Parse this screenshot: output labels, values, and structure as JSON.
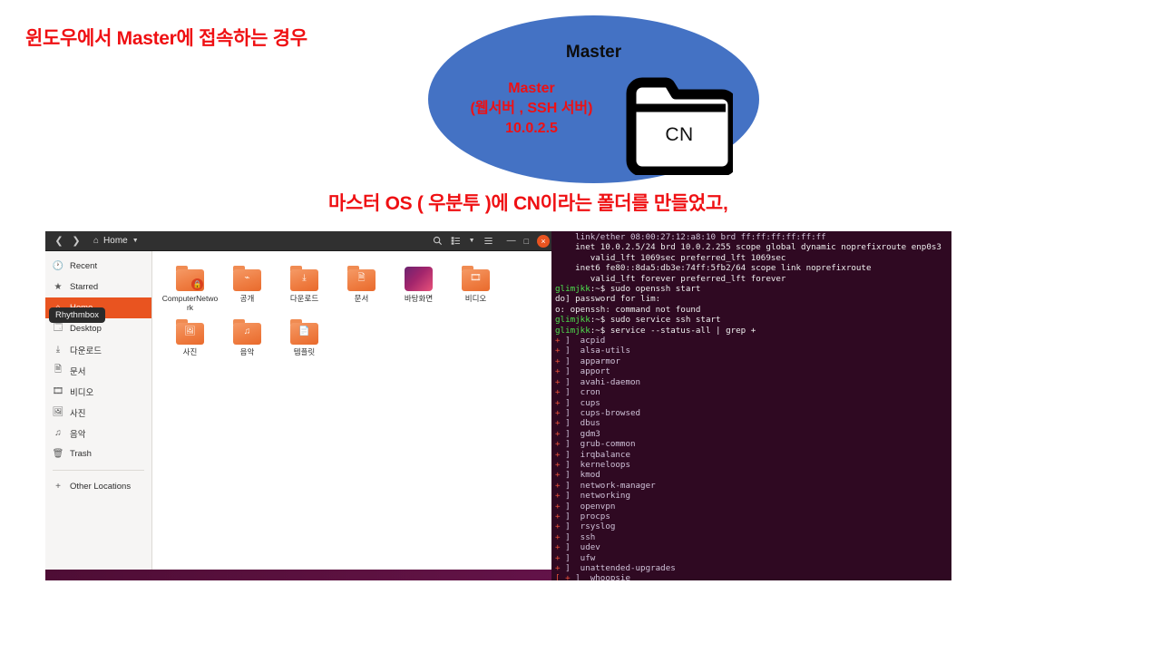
{
  "slide": {
    "heading": "윈도우에서 Master에 접속하는 경우",
    "caption": "마스터 OS ( 우분투 )에 CN이라는 폴더를 만들었고,",
    "heading_color": "#ef1013",
    "caption_color": "#ef1013"
  },
  "diagram": {
    "ellipse_color": "#4472c4",
    "title": "Master",
    "sub_line1": "Master",
    "sub_line2": "(웹서버 , SSH 서버)",
    "sub_line3": "10.0.2.5",
    "folder_label": "CN"
  },
  "file_manager": {
    "titlebar": {
      "back_icon": "chevron-left-icon",
      "forward_icon": "chevron-right-icon",
      "home_icon": "home-icon",
      "path_label": "Home",
      "path_caret": "chevron-down-icon",
      "search_icon": "search-icon",
      "view_icon": "list-view-icon",
      "view_caret": "chevron-down-icon",
      "menu_icon": "hamburger-menu-icon",
      "minimize_label": "—",
      "maximize_label": "□",
      "close_label": "×"
    },
    "tooltip": "Rhythmbox",
    "sidebar": [
      {
        "label": "Recent",
        "icon": "clock-icon",
        "glyph": "🕐",
        "active": false
      },
      {
        "label": "Starred",
        "icon": "star-icon",
        "glyph": "★",
        "active": false
      },
      {
        "label": "Home",
        "icon": "home-icon",
        "glyph": "⌂",
        "active": true
      },
      {
        "label": "Desktop",
        "icon": "desktop-icon",
        "glyph": "🗔",
        "active": false
      },
      {
        "label": "다운로드",
        "icon": "download-icon",
        "glyph": "⤓",
        "active": false
      },
      {
        "label": "문서",
        "icon": "document-icon",
        "glyph": "🗎",
        "active": false
      },
      {
        "label": "비디오",
        "icon": "video-icon",
        "glyph": "🎞",
        "active": false
      },
      {
        "label": "사진",
        "icon": "photo-icon",
        "glyph": "🖼",
        "active": false
      },
      {
        "label": "음악",
        "icon": "music-icon",
        "glyph": "♫",
        "active": false
      },
      {
        "label": "Trash",
        "icon": "trash-icon",
        "glyph": "🗑",
        "active": false
      }
    ],
    "other_locations": {
      "label": "Other Locations",
      "icon": "plus-icon",
      "glyph": "+"
    },
    "files": [
      {
        "label": "ComputerNetwork",
        "icon": "folder-locked-icon",
        "emblem": "",
        "locked": true,
        "kind": "folder"
      },
      {
        "label": "공개",
        "icon": "folder-shared-icon",
        "emblem": "⌁",
        "locked": false,
        "kind": "folder"
      },
      {
        "label": "다운로드",
        "icon": "folder-download-icon",
        "emblem": "⤓",
        "locked": false,
        "kind": "folder"
      },
      {
        "label": "문서",
        "icon": "folder-documents-icon",
        "emblem": "🗎",
        "locked": false,
        "kind": "folder"
      },
      {
        "label": "바탕화면",
        "icon": "folder-desktop-icon",
        "emblem": "",
        "locked": false,
        "kind": "desktop"
      },
      {
        "label": "비디오",
        "icon": "folder-videos-icon",
        "emblem": "🎞",
        "locked": false,
        "kind": "folder"
      },
      {
        "label": "사진",
        "icon": "folder-pictures-icon",
        "emblem": "🖼",
        "locked": false,
        "kind": "folder"
      },
      {
        "label": "음악",
        "icon": "folder-music-icon",
        "emblem": "♫",
        "locked": false,
        "kind": "folder"
      },
      {
        "label": "템플릿",
        "icon": "folder-templates-icon",
        "emblem": "📄",
        "locked": false,
        "kind": "folder"
      }
    ]
  },
  "terminal": {
    "lines": [
      {
        "segments": [
          {
            "text": "    link/ether 08:00:27:12:a8:10 brd ff:ff:ff:ff:ff:ff",
            "cls": "c-lav"
          }
        ]
      },
      {
        "segments": [
          {
            "text": "    inet 10.0.2.5/24 brd 10.0.2.255 scope global dynamic noprefixroute enp0s3",
            "cls": "c-white"
          }
        ]
      },
      {
        "segments": [
          {
            "text": "       valid_lft 1069sec preferred_lft 1069sec",
            "cls": "c-white"
          }
        ]
      },
      {
        "segments": [
          {
            "text": "    inet6 fe80::8da5:db3e:74ff:5fb2/64 scope link noprefixroute",
            "cls": "c-white"
          }
        ]
      },
      {
        "segments": [
          {
            "text": "       valid_lft forever preferred_lft forever",
            "cls": "c-white"
          }
        ]
      },
      {
        "segments": [
          {
            "text": "glimjkk",
            "cls": "c-green"
          },
          {
            "text": ":~$ sudo openssh start",
            "cls": "c-white"
          }
        ]
      },
      {
        "segments": [
          {
            "text": "do] password for lim:",
            "cls": "c-white"
          }
        ]
      },
      {
        "segments": [
          {
            "text": "o: openssh: command not found",
            "cls": "c-white"
          }
        ]
      },
      {
        "segments": [
          {
            "text": "glimjkk",
            "cls": "c-green"
          },
          {
            "text": ":~$ sudo service ssh start",
            "cls": "c-white"
          }
        ]
      },
      {
        "segments": [
          {
            "text": "glimjkk",
            "cls": "c-green"
          },
          {
            "text": ":~$ service --status-all | grep +",
            "cls": "c-white"
          }
        ]
      },
      {
        "segments": [
          {
            "text": "+ ",
            "cls": "c-red"
          },
          {
            "text": "]  acpid",
            "cls": "c-lav"
          }
        ]
      },
      {
        "segments": [
          {
            "text": "+ ",
            "cls": "c-red"
          },
          {
            "text": "]  alsa-utils",
            "cls": "c-lav"
          }
        ]
      },
      {
        "segments": [
          {
            "text": "+ ",
            "cls": "c-red"
          },
          {
            "text": "]  apparmor",
            "cls": "c-lav"
          }
        ]
      },
      {
        "segments": [
          {
            "text": "+ ",
            "cls": "c-red"
          },
          {
            "text": "]  apport",
            "cls": "c-lav"
          }
        ]
      },
      {
        "segments": [
          {
            "text": "+ ",
            "cls": "c-red"
          },
          {
            "text": "]  avahi-daemon",
            "cls": "c-lav"
          }
        ]
      },
      {
        "segments": [
          {
            "text": "+ ",
            "cls": "c-red"
          },
          {
            "text": "]  cron",
            "cls": "c-lav"
          }
        ]
      },
      {
        "segments": [
          {
            "text": "+ ",
            "cls": "c-red"
          },
          {
            "text": "]  cups",
            "cls": "c-lav"
          }
        ]
      },
      {
        "segments": [
          {
            "text": "+ ",
            "cls": "c-red"
          },
          {
            "text": "]  cups-browsed",
            "cls": "c-lav"
          }
        ]
      },
      {
        "segments": [
          {
            "text": "+ ",
            "cls": "c-red"
          },
          {
            "text": "]  dbus",
            "cls": "c-lav"
          }
        ]
      },
      {
        "segments": [
          {
            "text": "+ ",
            "cls": "c-red"
          },
          {
            "text": "]  gdm3",
            "cls": "c-lav"
          }
        ]
      },
      {
        "segments": [
          {
            "text": "+ ",
            "cls": "c-red"
          },
          {
            "text": "]  grub-common",
            "cls": "c-lav"
          }
        ]
      },
      {
        "segments": [
          {
            "text": "+ ",
            "cls": "c-red"
          },
          {
            "text": "]  irqbalance",
            "cls": "c-lav"
          }
        ]
      },
      {
        "segments": [
          {
            "text": "+ ",
            "cls": "c-red"
          },
          {
            "text": "]  kerneloops",
            "cls": "c-lav"
          }
        ]
      },
      {
        "segments": [
          {
            "text": "+ ",
            "cls": "c-red"
          },
          {
            "text": "]  kmod",
            "cls": "c-lav"
          }
        ]
      },
      {
        "segments": [
          {
            "text": "+ ",
            "cls": "c-red"
          },
          {
            "text": "]  network-manager",
            "cls": "c-lav"
          }
        ]
      },
      {
        "segments": [
          {
            "text": "+ ",
            "cls": "c-red"
          },
          {
            "text": "]  networking",
            "cls": "c-lav"
          }
        ]
      },
      {
        "segments": [
          {
            "text": "+ ",
            "cls": "c-red"
          },
          {
            "text": "]  openvpn",
            "cls": "c-lav"
          }
        ]
      },
      {
        "segments": [
          {
            "text": "+ ",
            "cls": "c-red"
          },
          {
            "text": "]  procps",
            "cls": "c-lav"
          }
        ]
      },
      {
        "segments": [
          {
            "text": "+ ",
            "cls": "c-red"
          },
          {
            "text": "]  rsyslog",
            "cls": "c-lav"
          }
        ]
      },
      {
        "segments": [
          {
            "text": "+ ",
            "cls": "c-red"
          },
          {
            "text": "]  ssh",
            "cls": "c-lav"
          }
        ]
      },
      {
        "segments": [
          {
            "text": "+ ",
            "cls": "c-red"
          },
          {
            "text": "]  udev",
            "cls": "c-lav"
          }
        ]
      },
      {
        "segments": [
          {
            "text": "+ ",
            "cls": "c-red"
          },
          {
            "text": "]  ufw",
            "cls": "c-lav"
          }
        ]
      },
      {
        "segments": [
          {
            "text": "+ ",
            "cls": "c-red"
          },
          {
            "text": "]  unattended-upgrades",
            "cls": "c-lav"
          }
        ]
      },
      {
        "segments": [
          {
            "text": "[ + ",
            "cls": "c-red"
          },
          {
            "text": "]  whoopsie",
            "cls": "c-lav"
          }
        ]
      }
    ]
  }
}
